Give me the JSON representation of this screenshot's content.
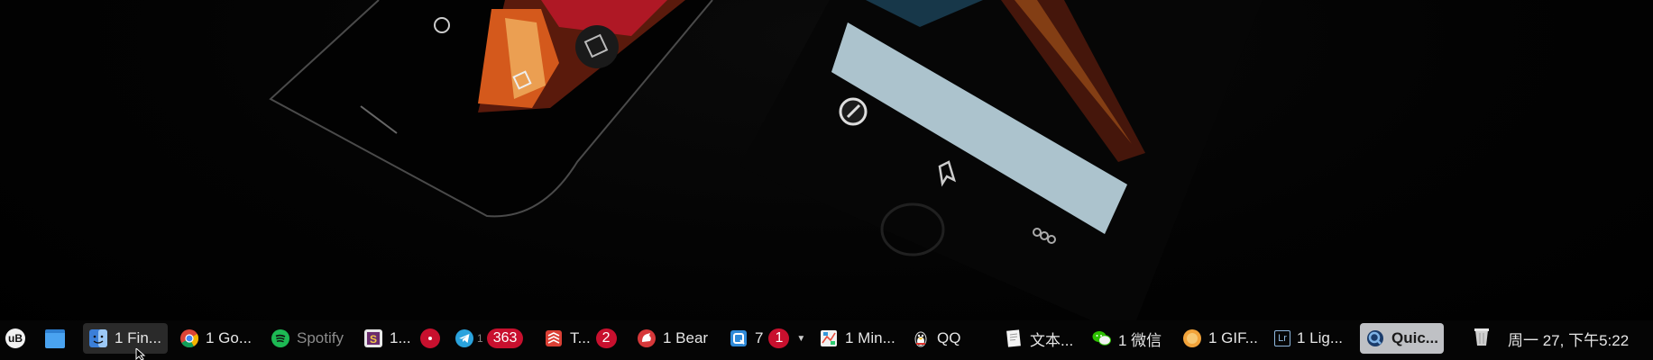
{
  "taskbar": {
    "launcher": {
      "label": "uB"
    },
    "items": [
      {
        "label": "1 Fin...",
        "icon": "finder-icon"
      },
      {
        "label": "1 Go...",
        "icon": "chrome-icon"
      },
      {
        "label": "Spotify",
        "icon": "spotify-icon"
      },
      {
        "label": "1...",
        "icon": "slack-icon",
        "badge": "•"
      },
      {
        "label": "363",
        "icon": "telegram-icon"
      },
      {
        "label": "T...",
        "icon": "todoist-icon",
        "badge": "2"
      },
      {
        "label": "1 Bear",
        "icon": "bear-icon"
      },
      {
        "label": "7",
        "icon": "qq-browser-icon",
        "badge": "1"
      },
      {
        "label": "1 Min...",
        "icon": "mindnode-icon"
      },
      {
        "label": "QQ",
        "icon": "qq-penguin-icon"
      },
      {
        "label": "文本...",
        "icon": "textedit-icon"
      },
      {
        "label": "1 微信",
        "icon": "wechat-icon"
      },
      {
        "label": "1 GIF...",
        "icon": "gif-brewery-icon"
      },
      {
        "label": "1 Lig...",
        "icon": "lightroom-icon",
        "icon_text": "Lr"
      },
      {
        "label": "Quic...",
        "icon": "quicktime-icon"
      }
    ],
    "clock": "周一 27, 下午5:22"
  },
  "colors": {
    "badge": "#c8102e",
    "focused_bg": "#bfc1c5",
    "active_bg": "#2a2a2a"
  }
}
